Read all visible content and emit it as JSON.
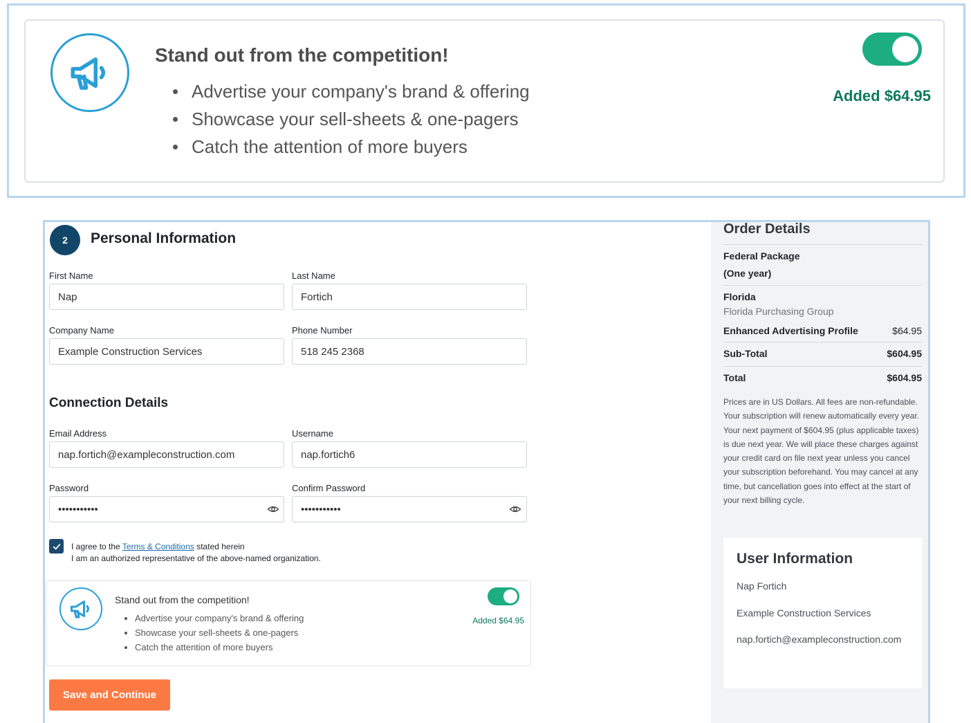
{
  "zoom_promo": {
    "title": "Stand out from the competition!",
    "bullets": [
      "Advertise your company's brand & offering",
      "Showcase your sell-sheets & one-pagers",
      "Catch the attention of more buyers"
    ],
    "toggle_on": true,
    "added_label": "Added $64.95",
    "icon": "megaphone-icon"
  },
  "step": {
    "number": "2",
    "title": "Personal Information"
  },
  "personal": {
    "first_name_label": "First Name",
    "first_name_value": "Nap",
    "last_name_label": "Last Name",
    "last_name_value": "Fortich",
    "company_label": "Company Name",
    "company_value": "Example Construction Services",
    "phone_label": "Phone Number",
    "phone_value": "518 245 2368"
  },
  "connection": {
    "title": "Connection Details",
    "email_label": "Email Address",
    "email_value": "nap.fortich@exampleconstruction.com",
    "username_label": "Username",
    "username_value": "nap.fortich6",
    "password_label": "Password",
    "password_value": "•••••••••••",
    "confirm_label": "Confirm Password",
    "confirm_value": "•••••••••••"
  },
  "agreement": {
    "checked": true,
    "prefix": "I agree to the ",
    "link": "Terms & Conditions",
    "suffix": " stated herein",
    "line2": "I am an authorized representative of the above-named organization."
  },
  "promo": {
    "title": "Stand out from the competition!",
    "bullets": [
      "Advertise your company's brand & offering",
      "Showcase your sell-sheets & one-pagers",
      "Catch the attention of more buyers"
    ],
    "toggle_on": true,
    "added_label": "Added $64.95",
    "icon": "megaphone-icon"
  },
  "save_button": "Save and Continue",
  "order": {
    "title": "Order Details",
    "package": "Federal Package",
    "package_term": "(One year)",
    "state": "Florida",
    "group": "Florida Purchasing Group",
    "addon_label": "Enhanced Advertising Profile",
    "addon_price": "$64.95",
    "subtotal_label": "Sub-Total",
    "subtotal_value": "$604.95",
    "total_label": "Total",
    "total_value": "$604.95",
    "disclaimer": "Prices are in US Dollars. All fees are non-refundable. Your subscription will renew automatically every year. Your next payment of $604.95 (plus applicable taxes) is due next year. We will place these charges against your credit card on file next year unless you cancel your subscription beforehand. You may cancel at any time, but cancellation goes into effect at the start of your next billing cycle."
  },
  "user_info": {
    "title": "User Information",
    "name": "Nap Fortich",
    "company": "Example Construction Services",
    "email": "nap.fortich@exampleconstruction.com"
  },
  "colors": {
    "accent_green": "#1cad80",
    "step_badge": "#124669",
    "primary_button": "#fb7a43",
    "icon_blue": "#2a9fd8"
  }
}
